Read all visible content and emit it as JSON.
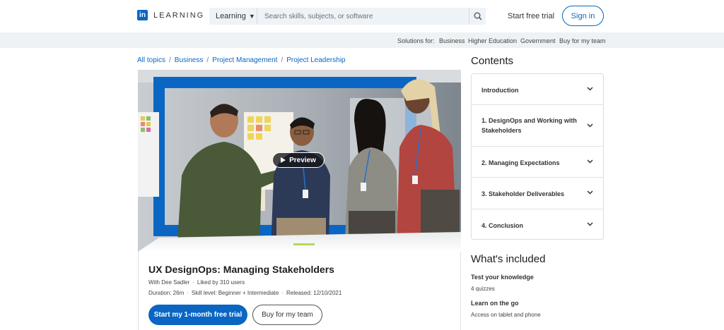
{
  "header": {
    "logo_mark": "in",
    "logo_text": "LEARNING",
    "search_category": "Learning",
    "search_placeholder": "Search skills, subjects, or software",
    "free_trial": "Start free trial",
    "sign_in": "Sign in"
  },
  "solutions": {
    "label": "Solutions for:",
    "items": [
      "Business",
      "Higher Education",
      "Government",
      "Buy for my team"
    ]
  },
  "breadcrumb": [
    "All topics",
    "Business",
    "Project Management",
    "Project Leadership"
  ],
  "hero": {
    "preview_label": "Preview"
  },
  "course": {
    "title": "UX DesignOps: Managing Stakeholders",
    "author": "With Dee Sadler",
    "likes": "Liked by 310 users",
    "duration": "Duration: 26m",
    "skill": "Skill level: Beginner + Intermediate",
    "released": "Released: 12/10/2021",
    "trial_button": "Start my 1-month free trial",
    "buy_button": "Buy for my team"
  },
  "contents": {
    "title": "Contents",
    "items": [
      {
        "label": "Introduction"
      },
      {
        "label": "1. DesignOps and Working with Stakeholders"
      },
      {
        "label": "2. Managing Expectations"
      },
      {
        "label": "3. Stakeholder Deliverables"
      },
      {
        "label": "4. Conclusion"
      }
    ]
  },
  "included": {
    "title": "What's included",
    "items": [
      {
        "heading": "Test your knowledge",
        "detail": "4 quizzes"
      },
      {
        "heading": "Learn on the go",
        "detail": "Access on tablet and phone"
      }
    ]
  },
  "colors": {
    "brand": "#0a66c2",
    "solutions_bg": "#eef2f5",
    "search_bg": "#eef3f8"
  }
}
